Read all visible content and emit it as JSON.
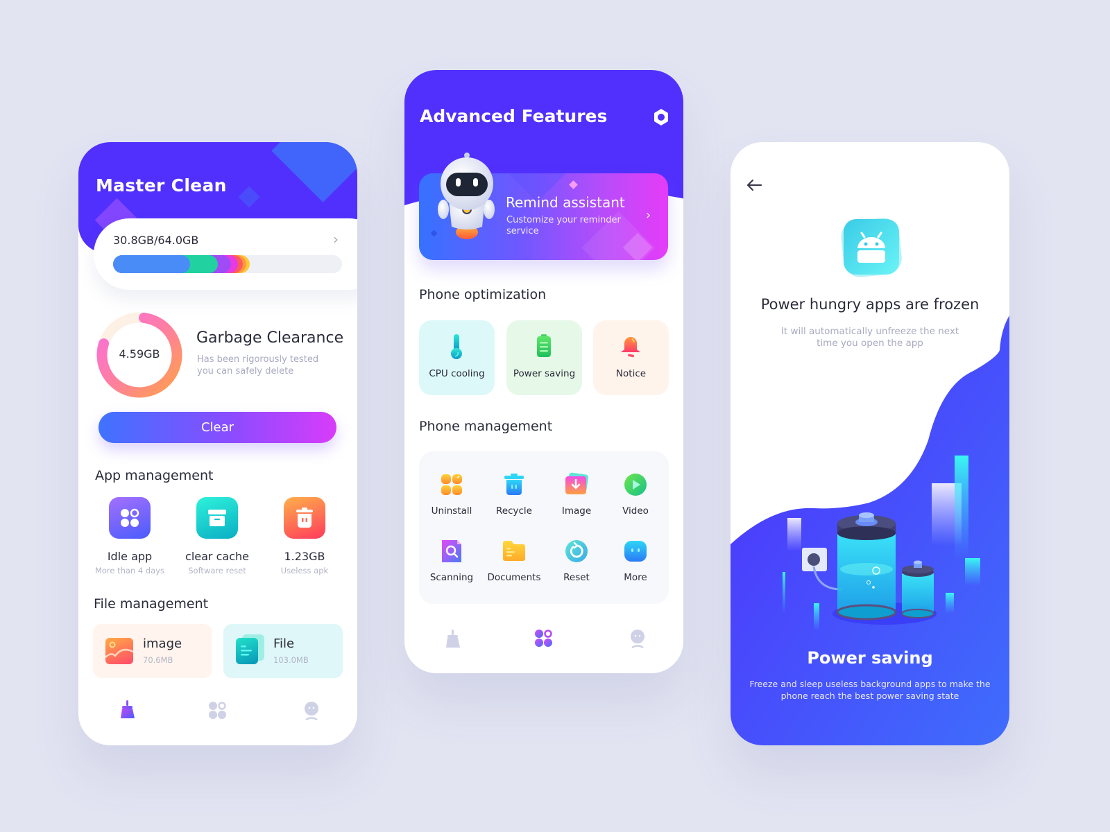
{
  "theme": {
    "background": "#e2e4f2",
    "primary": "#5130fd",
    "text_dark": "#2b2c3a",
    "text_muted": "#a8aac0",
    "gradient_start": "#3f72ff",
    "gradient_end": "#d83cfa"
  },
  "phone1": {
    "title": "Master Clean",
    "storage": {
      "text": "30.8GB/64.0GB",
      "used_fraction": 0.56,
      "segments": [
        {
          "name": "blue",
          "color": "#4a8cf7",
          "fraction": 0.3
        },
        {
          "name": "green",
          "color": "#21d19f",
          "fraction": 0.12
        },
        {
          "name": "purple",
          "color": "#a14bf6",
          "fraction": 0.06
        },
        {
          "name": "magenta",
          "color": "#e83ae0",
          "fraction": 0.03
        },
        {
          "name": "red",
          "color": "#ff5a5a",
          "fraction": 0.02
        },
        {
          "name": "orange",
          "color": "#ff9a3a",
          "fraction": 0.015
        },
        {
          "name": "yellow",
          "color": "#ffca3a",
          "fraction": 0.015
        }
      ],
      "chevron_icon": "chevron-right-icon"
    },
    "garbage": {
      "value": "4.59GB",
      "ring_fraction": 0.78,
      "title": "Garbage Clearance",
      "desc_line1": "Has been rigorously tested",
      "desc_line2": "you can safely delete"
    },
    "clear_button": "Clear",
    "app_management": {
      "title": "App management",
      "items": [
        {
          "label": "Idle app",
          "sub": "More than 4 days",
          "icon": "apps-grid-icon"
        },
        {
          "label": "clear cache",
          "sub": "Software reset",
          "icon": "archive-box-icon"
        },
        {
          "label": "1.23GB",
          "sub": "Useless apk",
          "icon": "trash-icon"
        }
      ]
    },
    "file_management": {
      "title": "File management",
      "items": [
        {
          "label": "image",
          "size": "70.6MB",
          "icon": "image-icon"
        },
        {
          "label": "File",
          "size": "103.0MB",
          "icon": "document-icon"
        }
      ]
    },
    "tabbar": [
      {
        "icon": "broom-icon",
        "active": true
      },
      {
        "icon": "apps-grid-icon",
        "active": false
      },
      {
        "icon": "profile-icon",
        "active": false
      }
    ]
  },
  "phone2": {
    "title": "Advanced Features",
    "settings_icon": "gear-icon",
    "remind": {
      "title": "Remind assistant",
      "desc": "Customize your reminder service",
      "icon": "robot-mascot-icon"
    },
    "optimization": {
      "title": "Phone optimization",
      "items": [
        {
          "label": "CPU cooling",
          "icon": "thermometer-icon",
          "bg": "#dcf8f8"
        },
        {
          "label": "Power saving",
          "icon": "battery-icon",
          "bg": "#e6f8e8"
        },
        {
          "label": "Notice",
          "icon": "bell-icon",
          "bg": "#fff4ec"
        }
      ]
    },
    "management": {
      "title": "Phone management",
      "items": [
        {
          "label": "Uninstall",
          "icon": "uninstall-icon"
        },
        {
          "label": "Recycle",
          "icon": "recycle-bin-icon"
        },
        {
          "label": "Image",
          "icon": "image-download-icon"
        },
        {
          "label": "Video",
          "icon": "play-icon"
        },
        {
          "label": "Scanning",
          "icon": "scan-search-icon"
        },
        {
          "label": "Documents",
          "icon": "folder-icon"
        },
        {
          "label": "Reset",
          "icon": "reset-icon"
        },
        {
          "label": "More",
          "icon": "more-icon"
        }
      ]
    },
    "tabbar": [
      {
        "icon": "broom-icon",
        "active": false
      },
      {
        "icon": "apps-grid-icon",
        "active": true
      },
      {
        "icon": "profile-icon",
        "active": false
      }
    ]
  },
  "phone3": {
    "back_icon": "arrow-left-icon",
    "title": "Power hungry apps are frozen",
    "desc_line1": "It will automatically unfreeze the next",
    "desc_line2": "time you open the app",
    "power_title": "Power saving",
    "power_desc_line1": "Freeze and sleep useless background apps to make the",
    "power_desc_line2": "phone reach the best power saving state"
  }
}
